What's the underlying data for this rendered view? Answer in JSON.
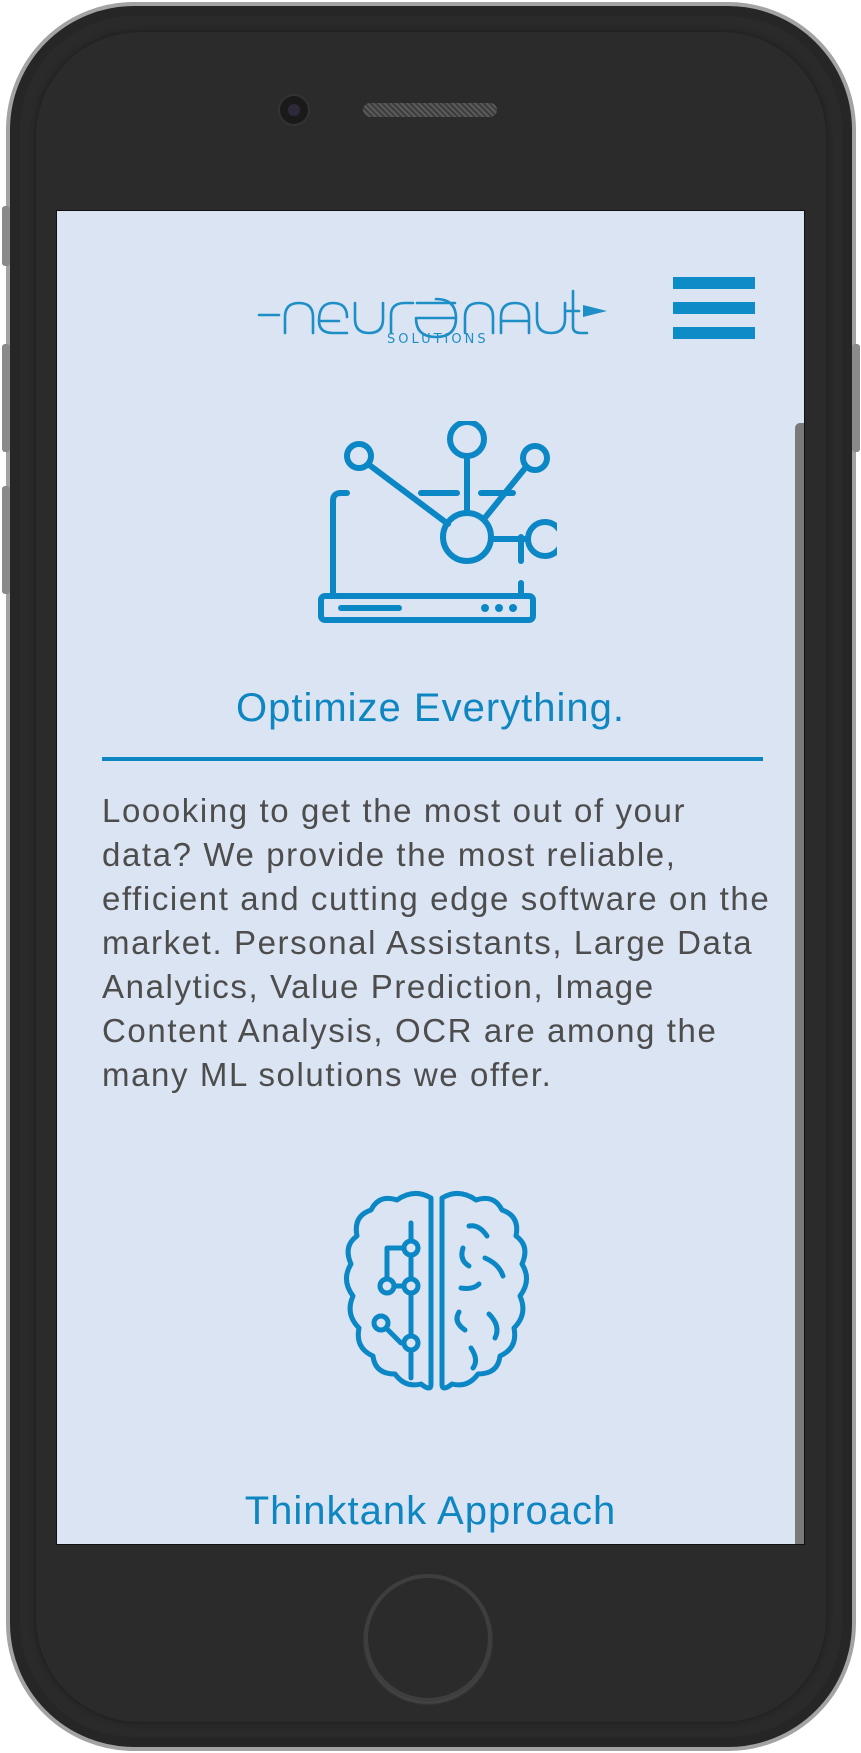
{
  "brand": {
    "name": "neuronaut",
    "subtitle": "SOLUTIONS"
  },
  "header": {
    "menu_icon": "hamburger-menu-icon"
  },
  "sections": [
    {
      "icon": "laptop-network-icon",
      "title": "Optimize Everything.",
      "text": "Loooking to get the most out of your data? We provide the most reliable, efficient and cutting edge software on the market. Personal Assistants, Large Data Analytics, Value Prediction, Image Content Analysis, OCR are among the many ML solutions we offer."
    },
    {
      "icon": "brain-circuit-icon",
      "title": "Thinktank Approach"
    }
  ],
  "colors": {
    "accent": "#0e86c1",
    "background": "#dbe4f2",
    "text": "#4d4d4d",
    "device": "#2a2a2a"
  }
}
